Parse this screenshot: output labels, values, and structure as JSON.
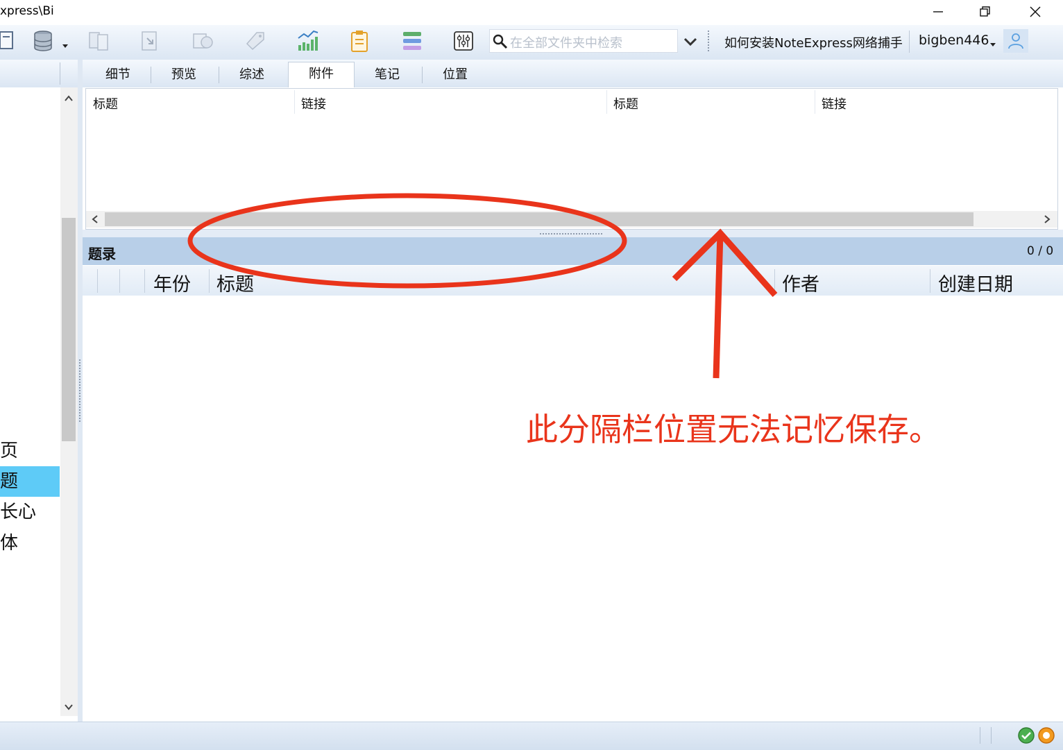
{
  "window": {
    "title": "xpress\\Bi",
    "minimize_icon": "minimize-icon",
    "restore_icon": "restore-icon",
    "close_icon": "close-icon"
  },
  "toolbar": {
    "search_placeholder": "在全部文件夹中检索",
    "help_link": "如何安装NoteExpress网络捕手",
    "user_name": "bigben446",
    "icons": [
      "document-icon",
      "database-icon",
      "compare-icon",
      "export-icon",
      "convert-icon",
      "tag-icon",
      "chart-icon",
      "clipboard-icon",
      "layers-icon",
      "settings-sliders-icon",
      "search-icon",
      "chevron-down-icon",
      "user-icon"
    ]
  },
  "left_panel": {
    "items": [
      {
        "label": "页",
        "selected": false
      },
      {
        "label": "题",
        "selected": true
      },
      {
        "label": "长心",
        "selected": false
      },
      {
        "label": "体",
        "selected": false
      }
    ]
  },
  "tabs": [
    {
      "label": "细节",
      "active": false
    },
    {
      "label": "预览",
      "active": false
    },
    {
      "label": "综述",
      "active": false
    },
    {
      "label": "附件",
      "active": true
    },
    {
      "label": "笔记",
      "active": false
    },
    {
      "label": "位置",
      "active": false
    }
  ],
  "attachments": {
    "columns": [
      "标题",
      "链接",
      "标题",
      "链接"
    ]
  },
  "records": {
    "title": "题录",
    "count": "0 / 0",
    "columns": [
      "年份",
      "标题",
      "作者",
      "创建日期"
    ]
  },
  "annotation": {
    "text": "此分隔栏位置无法记忆保存。",
    "color": "#e9341b"
  },
  "colors": {
    "selected": "#5ecbf7",
    "toolbar_bg": "#dbe6f3",
    "records_header": "#b8cfe8"
  }
}
